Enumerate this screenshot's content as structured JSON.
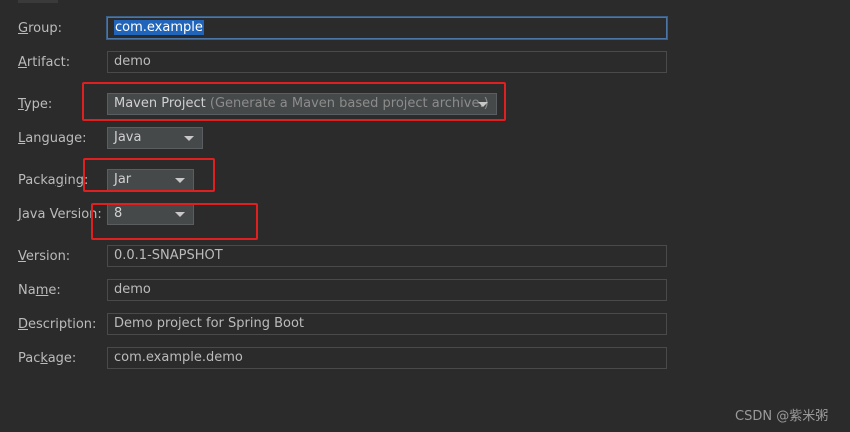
{
  "form": {
    "group": {
      "label_mn": "G",
      "label_rest": "roup:",
      "value": "com.example"
    },
    "artifact": {
      "label_mn": "A",
      "label_rest": "rtifact:",
      "value": "demo"
    },
    "type": {
      "label_mn": "T",
      "label_rest": "ype:",
      "value": "Maven Project",
      "hint": "(Generate a Maven based project archive.)"
    },
    "language": {
      "label_mn": "L",
      "label_rest": "anguage:",
      "value": "Java"
    },
    "packaging": {
      "label_pre": "Packa",
      "label_mn": "g",
      "label_rest": "ing:",
      "value": "Jar"
    },
    "java_version": {
      "label_mn": "J",
      "label_rest": "ava Version:",
      "value": "8"
    },
    "version": {
      "label_mn": "V",
      "label_rest": "ersion:",
      "value": "0.0.1-SNAPSHOT"
    },
    "name": {
      "label_pre": "Na",
      "label_mn": "m",
      "label_rest": "e:",
      "value": "demo"
    },
    "description": {
      "label_mn": "D",
      "label_rest": "escription:",
      "value": "Demo project for Spring Boot"
    },
    "package": {
      "label_pre": "Pac",
      "label_mn": "k",
      "label_rest": "age:",
      "value": "com.example.demo"
    }
  },
  "watermark": "CSDN @紫米粥",
  "colors": {
    "background": "#2b2b2b",
    "highlight_box": "#e02020",
    "selection": "#2065b9"
  },
  "icons": {
    "dropdown": "chevron-down-icon"
  }
}
